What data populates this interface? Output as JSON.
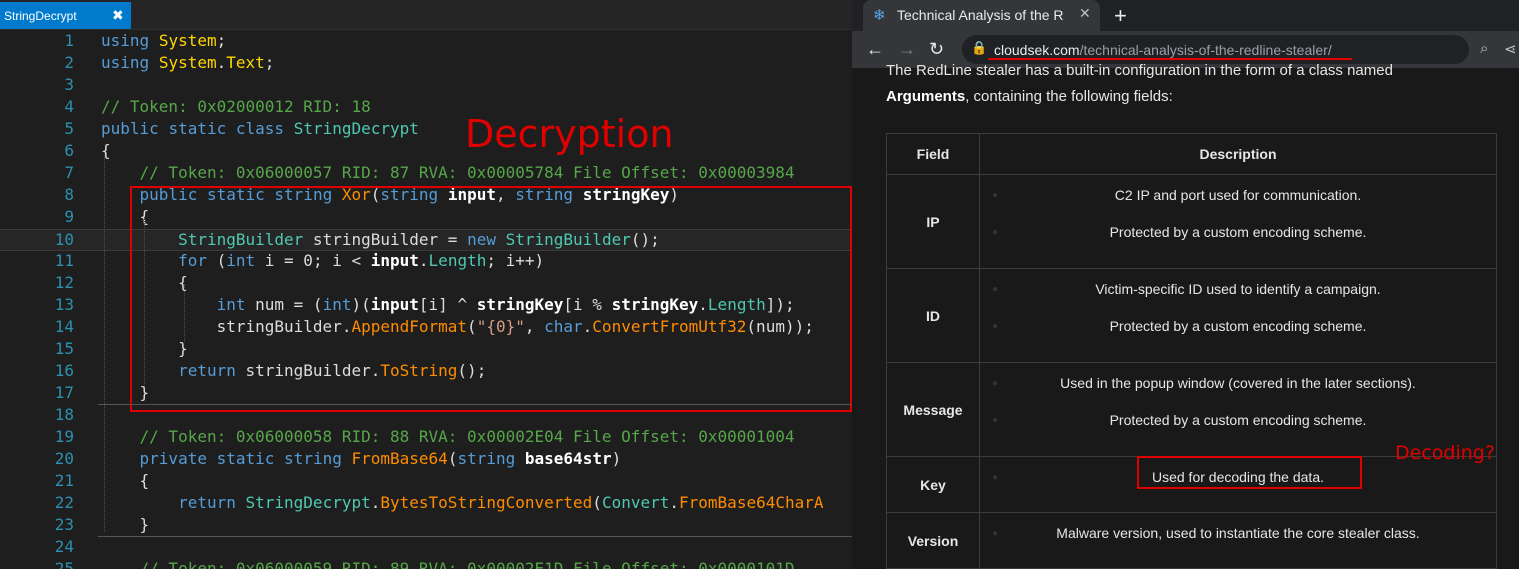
{
  "editor": {
    "tab_label": "StringDecrypt",
    "tab_close": "✖",
    "annotation": "Decryption",
    "lines": [
      {
        "n": "1",
        "t": "using System;"
      },
      {
        "n": "2",
        "t": "using System.Text;"
      },
      {
        "n": "3",
        "t": ""
      },
      {
        "n": "4",
        "t": "// Token: 0x02000012 RID: 18"
      },
      {
        "n": "5",
        "t": "public static class StringDecrypt"
      },
      {
        "n": "6",
        "t": "{"
      },
      {
        "n": "7",
        "t": "    // Token: 0x06000057 RID: 87 RVA: 0x00005784 File Offset: 0x00003984"
      },
      {
        "n": "8",
        "t": "    public static string Xor(string input, string stringKey)"
      },
      {
        "n": "9",
        "t": "    {"
      },
      {
        "n": "10",
        "t": "        StringBuilder stringBuilder = new StringBuilder();"
      },
      {
        "n": "11",
        "t": "        for (int i = 0; i < input.Length; i++)"
      },
      {
        "n": "12",
        "t": "        {"
      },
      {
        "n": "13",
        "t": "            int num = (int)(input[i] ^ stringKey[i % stringKey.Length]);"
      },
      {
        "n": "14",
        "t": "            stringBuilder.AppendFormat(\"{0}\", char.ConvertFromUtf32(num));"
      },
      {
        "n": "15",
        "t": "        }"
      },
      {
        "n": "16",
        "t": "        return stringBuilder.ToString();"
      },
      {
        "n": "17",
        "t": "    }"
      },
      {
        "n": "18",
        "t": ""
      },
      {
        "n": "19",
        "t": "    // Token: 0x06000058 RID: 88 RVA: 0x00002E04 File Offset: 0x00001004"
      },
      {
        "n": "20",
        "t": "    private static string FromBase64(string base64str)"
      },
      {
        "n": "21",
        "t": "    {"
      },
      {
        "n": "22",
        "t": "        return StringDecrypt.BytesToStringConverted(Convert.FromBase64CharA"
      },
      {
        "n": "23",
        "t": "    }"
      },
      {
        "n": "24",
        "t": ""
      },
      {
        "n": "25",
        "t": "    // Token: 0x06000059 RID: 89 RVA: 0x00002E1D File Offset: 0x0000101D"
      }
    ]
  },
  "browser": {
    "tab_title": "Technical Analysis of the R",
    "tab_close": "✕",
    "new_tab": "+",
    "url_domain": "cloudsek.com",
    "url_path": "/technical-analysis-of-the-redline-stealer/",
    "content": {
      "intro_line1": "The RedLine stealer has a built-in configuration in the form of a class named",
      "intro_bold": "Arguments",
      "intro_line2_rest": ", containing the following fields:",
      "table_headers": [
        "Field",
        "Description"
      ],
      "rows": [
        {
          "field": "IP",
          "bullets": [
            "C2 IP and port used for communication.",
            "Protected by a custom encoding scheme."
          ]
        },
        {
          "field": "ID",
          "bullets": [
            "Victim-specific ID used to identify a campaign.",
            "Protected by a custom encoding scheme."
          ]
        },
        {
          "field": "Message",
          "bullets": [
            "Used in the popup window (covered in the later sections).",
            "Protected by a custom encoding scheme."
          ]
        },
        {
          "field": "Key",
          "bullets": [
            "Used for decoding the data."
          ]
        },
        {
          "field": "Version",
          "bullets": [
            "Malware version, used to instantiate the core stealer class."
          ]
        }
      ],
      "annotation": "Decoding?"
    }
  },
  "colors": {
    "annotation_red": "#e00000",
    "tab_blue": "#007acc"
  }
}
